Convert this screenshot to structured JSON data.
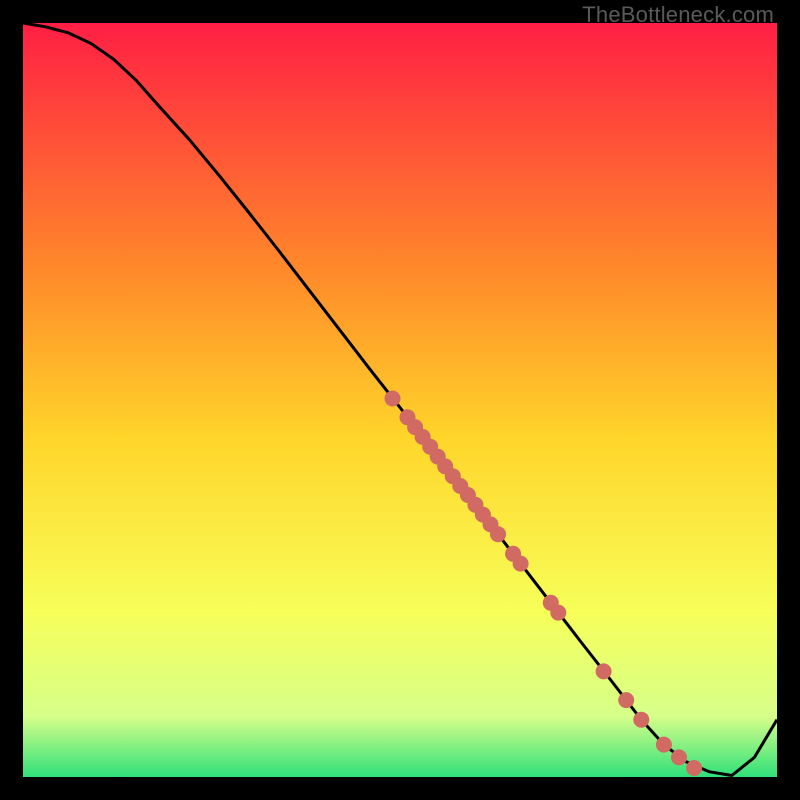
{
  "watermark": "TheBottleneck.com",
  "colors": {
    "gradient_top": "#ff1f44",
    "gradient_mid_upper": "#ff8a2a",
    "gradient_mid": "#ffd52a",
    "gradient_mid_lower": "#f7ff59",
    "gradient_low": "#d6ff8a",
    "gradient_bottom": "#2fe07a",
    "curve": "#000000",
    "dots": "#d16a62"
  },
  "chart_data": {
    "type": "line",
    "title": "",
    "xlabel": "",
    "ylabel": "",
    "xlim": [
      0,
      100
    ],
    "ylim": [
      0,
      100
    ],
    "series": [
      {
        "name": "bottleneck-curve",
        "x": [
          0,
          3,
          6,
          9,
          12,
          15,
          18,
          22,
          26,
          30,
          34,
          38,
          42,
          46,
          50,
          54,
          58,
          62,
          66,
          70,
          74,
          78,
          82,
          85,
          88,
          91,
          94,
          97,
          100
        ],
        "y": [
          100,
          99.5,
          98.7,
          97.3,
          95.2,
          92.4,
          89,
          84.6,
          79.8,
          74.8,
          69.7,
          64.5,
          59.3,
          54.1,
          49,
          43.8,
          38.6,
          33.5,
          28.3,
          23.1,
          17.9,
          12.8,
          7.6,
          4.3,
          2.0,
          0.7,
          0.2,
          2.6,
          7.6
        ]
      },
      {
        "name": "highlight-dots",
        "x": [
          49,
          51,
          52,
          53,
          54,
          55,
          56,
          57,
          58,
          59,
          60,
          61,
          62,
          63,
          65,
          66,
          70,
          71,
          77,
          80,
          82,
          85,
          87,
          89
        ],
        "y": [
          50.2,
          47.7,
          46.4,
          45.1,
          43.8,
          42.5,
          41.2,
          39.9,
          38.6,
          37.4,
          36.1,
          34.8,
          33.5,
          32.2,
          29.6,
          28.3,
          23.1,
          21.8,
          14.0,
          10.2,
          7.6,
          4.3,
          2.6,
          1.2
        ]
      }
    ]
  }
}
